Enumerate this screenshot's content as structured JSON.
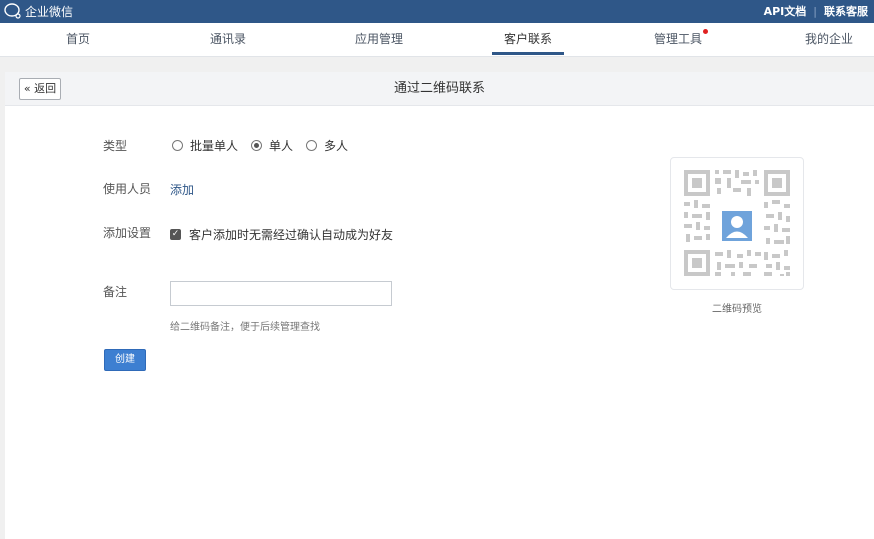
{
  "topbar": {
    "logo_text": "企业微信",
    "api_docs": "API文档",
    "separator": "|",
    "contact_service": "联系客服"
  },
  "nav": {
    "items": [
      {
        "label": "首页"
      },
      {
        "label": "通讯录"
      },
      {
        "label": "应用管理"
      },
      {
        "label": "客户联系",
        "active": true
      },
      {
        "label": "管理工具",
        "badge": true
      },
      {
        "label": "我的企业"
      }
    ]
  },
  "panel": {
    "back_label": "« 返回",
    "title": "通过二维码联系"
  },
  "form": {
    "type_label": "类型",
    "type_options": [
      "批量单人",
      "单人",
      "多人"
    ],
    "type_selected": "单人",
    "users_label": "使用人员",
    "add_link": "添加",
    "settings_label": "添加设置",
    "auto_accept_label": "客户添加时无需经过确认自动成为好友",
    "auto_accept_checked": true,
    "note_label": "备注",
    "note_value": "",
    "note_hint": "给二维码备注，便于后续管理查找",
    "create_button": "创建"
  },
  "qr": {
    "preview_label": "二维码预览"
  },
  "colors": {
    "header_bg": "#2f5788",
    "primary_button": "#3d7fd1",
    "link": "#2f5788"
  }
}
